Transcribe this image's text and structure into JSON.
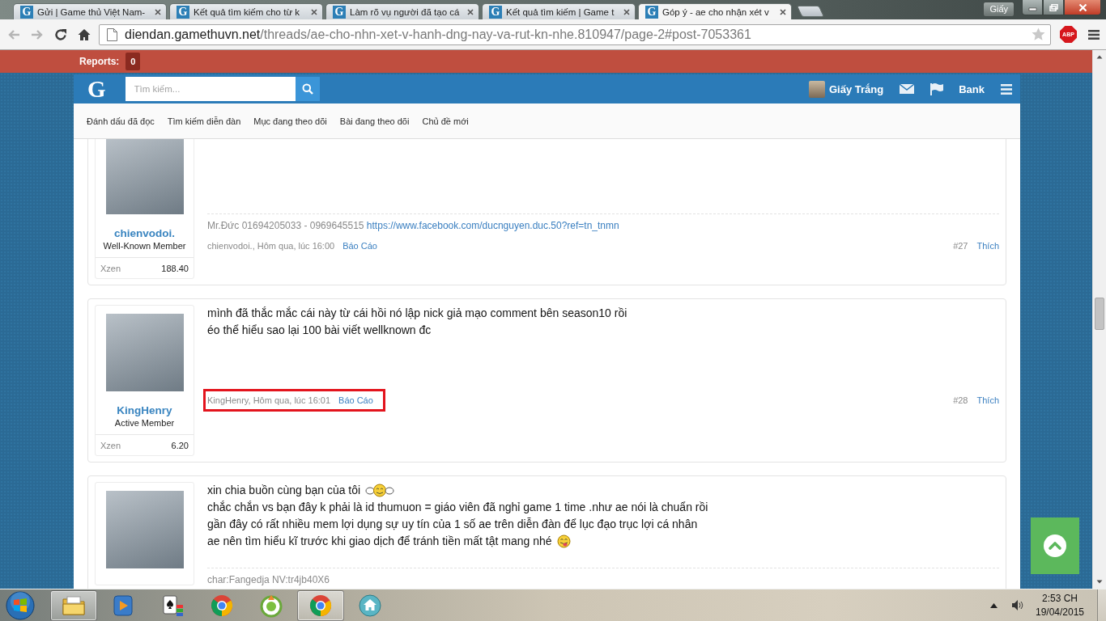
{
  "browser": {
    "tabs": [
      {
        "favicon": "G",
        "title": "Gửi | Game thủ Việt Nam-",
        "selected": false
      },
      {
        "favicon": "G",
        "title": "Kết quả tìm kiếm cho từ k",
        "selected": false
      },
      {
        "favicon": "G",
        "title": "Làm rõ vụ người đã tạo cá",
        "selected": false
      },
      {
        "favicon": "G",
        "title": "Kết quả tìm kiếm | Game t",
        "selected": false
      },
      {
        "favicon": "G",
        "title": "Góp ý - ae cho nhận xét v",
        "selected": true
      }
    ],
    "profile_button": "Giấy",
    "address": {
      "host": "diendan.gamethuvn.net",
      "path": "/threads/ae-cho-nhn-xet-v-hanh-dng-nay-va-rut-kn-nhe.810947/page-2#post-7053361"
    },
    "adblock_label": "ABP"
  },
  "reports_bar": {
    "label": "Reports:",
    "count": "0"
  },
  "header": {
    "logo": "G",
    "search": {
      "placeholder": "Tìm kiếm..."
    },
    "user_name": "Giấy Trắng",
    "bank": "Bank"
  },
  "nav": [
    "Đánh dấu đã đọc",
    "Tìm kiếm diễn đàn",
    "Mục đang theo dõi",
    "Bài đang theo dõi",
    "Chủ đề mới"
  ],
  "posts": [
    {
      "user": {
        "name": "chienvodoi.",
        "role": "Well-Known Member",
        "stat_label": "Xzen",
        "stat_value": "188.40"
      },
      "signature": {
        "text": "Mr.Đức 01694205033 - 0969645515",
        "link": "https://www.facebook.com/ducnguyen.duc.50?ref=tn_tnmn"
      },
      "meta": {
        "byline": "chienvodoi., Hôm qua, lúc 16:00",
        "report": "Báo Cáo",
        "highlighted": false
      },
      "number": "#27",
      "like": "Thích"
    },
    {
      "user": {
        "name": "KingHenry",
        "role": "Active Member",
        "stat_label": "Xzen",
        "stat_value": "6.20"
      },
      "message": [
        {
          "kind": "plain",
          "text": "mình đã thắc mắc cái này từ cái hồi nó lập nick giả mạo comment bên season10 rồi"
        },
        {
          "kind": "plain",
          "text": "éo thể hiểu sao lại 100 bài viết wellknown đc"
        }
      ],
      "meta": {
        "byline": "KingHenry, Hôm qua, lúc 16:01",
        "report": "Báo Cáo",
        "highlighted": true
      },
      "number": "#28",
      "like": "Thích"
    },
    {
      "message": [
        {
          "kind": "wave",
          "text": "xin chia buồn cùng bạn của tôi"
        },
        {
          "kind": "plain",
          "text": "chắc chắn vs bạn đây k phải là id thumuon = giáo viên đã nghỉ game 1 time .như ae nói là chuẩn rồi"
        },
        {
          "kind": "plain",
          "text": "gần đây có rất nhiều mem lợi dụng sự uy tín của 1 số ae trên diễn đàn để lục đạo trục lợi cá nhân"
        },
        {
          "kind": "tongue",
          "text": "ae nên tìm hiểu kĩ trước khi giao dịch để tránh tiền mất tật mang nhé"
        }
      ],
      "signature": {
        "text": "char:Fangedja NV:tr4jb40X6"
      }
    }
  ],
  "taskbar": {
    "apps": [
      {
        "kind": "folder",
        "selected": true
      },
      {
        "kind": "media",
        "selected": false
      },
      {
        "kind": "cards",
        "selected": false
      },
      {
        "kind": "browser",
        "selected": false
      },
      {
        "kind": "round",
        "selected": false
      },
      {
        "kind": "browser",
        "selected": true
      },
      {
        "kind": "home",
        "selected": false
      }
    ],
    "time": "2:53 CH",
    "date": "19/04/2015"
  }
}
